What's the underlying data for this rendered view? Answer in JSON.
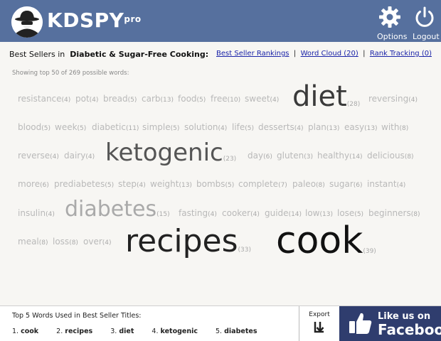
{
  "header": {
    "brand": "KDSPY",
    "brand_super": "pro",
    "options_label": "Options",
    "logout_label": "Logout"
  },
  "subheader": {
    "prefix": "Best Sellers in",
    "category": "Diabetic & Sugar-Free Cooking:",
    "links": [
      "Best Seller Rankings",
      "Word Cloud (20)",
      "Rank Tracking (0)"
    ],
    "separator": "|"
  },
  "showing_text": "Showing top 50 of 269 possible words:",
  "cloud": [
    {
      "word": "resistance",
      "count": "(4)"
    },
    {
      "word": "pot",
      "count": "(4)"
    },
    {
      "word": "bread",
      "count": "(5)"
    },
    {
      "word": "carb",
      "count": "(13)"
    },
    {
      "word": "food",
      "count": "(5)"
    },
    {
      "word": "free",
      "count": "(10)"
    },
    {
      "word": "sweet",
      "count": "(4)"
    },
    {
      "word": "diet",
      "count": "(28)"
    },
    {
      "word": "reversing",
      "count": "(4)"
    },
    {
      "word": "blood",
      "count": "(5)"
    },
    {
      "word": "week",
      "count": "(5)"
    },
    {
      "word": "diabetic",
      "count": "(11)"
    },
    {
      "word": "simple",
      "count": "(5)"
    },
    {
      "word": "solution",
      "count": "(4)"
    },
    {
      "word": "life",
      "count": "(5)"
    },
    {
      "word": "desserts",
      "count": "(4)"
    },
    {
      "word": "plan",
      "count": "(13)"
    },
    {
      "word": "easy",
      "count": "(13)"
    },
    {
      "word": "with",
      "count": "(8)"
    },
    {
      "word": "reverse",
      "count": "(4)"
    },
    {
      "word": "dairy",
      "count": "(4)"
    },
    {
      "word": "ketogenic",
      "count": "(23)"
    },
    {
      "word": "day",
      "count": "(6)"
    },
    {
      "word": "gluten",
      "count": "(3)"
    },
    {
      "word": "healthy",
      "count": "(14)"
    },
    {
      "word": "delicious",
      "count": "(8)"
    },
    {
      "word": "more",
      "count": "(6)"
    },
    {
      "word": "prediabetes",
      "count": "(5)"
    },
    {
      "word": "step",
      "count": "(4)"
    },
    {
      "word": "weight",
      "count": "(13)"
    },
    {
      "word": "bombs",
      "count": "(5)"
    },
    {
      "word": "complete",
      "count": "(7)"
    },
    {
      "word": "paleo",
      "count": "(8)"
    },
    {
      "word": "sugar",
      "count": "(6)"
    },
    {
      "word": "instant",
      "count": "(4)"
    },
    {
      "word": "insulin",
      "count": "(4)"
    },
    {
      "word": "diabetes",
      "count": "(15)"
    },
    {
      "word": "fasting",
      "count": "(4)"
    },
    {
      "word": "cooker",
      "count": "(4)"
    },
    {
      "word": "guide",
      "count": "(14)"
    },
    {
      "word": "low",
      "count": "(13)"
    },
    {
      "word": "lose",
      "count": "(5)"
    },
    {
      "word": "beginners",
      "count": "(8)"
    },
    {
      "word": "meal",
      "count": "(8)"
    },
    {
      "word": "loss",
      "count": "(8)"
    },
    {
      "word": "over",
      "count": "(4)"
    },
    {
      "word": "recipes",
      "count": "(33)"
    },
    {
      "word": "cook",
      "count": "(39)"
    }
  ],
  "footer": {
    "top5_title": "Top 5 Words Used in Best Seller Titles:",
    "top5": [
      {
        "n": "1.",
        "word": "cook"
      },
      {
        "n": "2.",
        "word": "recipes"
      },
      {
        "n": "3.",
        "word": "diet"
      },
      {
        "n": "4.",
        "word": "ketogenic"
      },
      {
        "n": "5.",
        "word": "diabetes"
      }
    ],
    "export_label": "Export",
    "fb_like": "Like us on",
    "fb_name": "Facebook"
  },
  "colors": {
    "header_bg": "#56709e",
    "link": "#1a23a8",
    "facebook_bg": "#2f3d6e"
  }
}
